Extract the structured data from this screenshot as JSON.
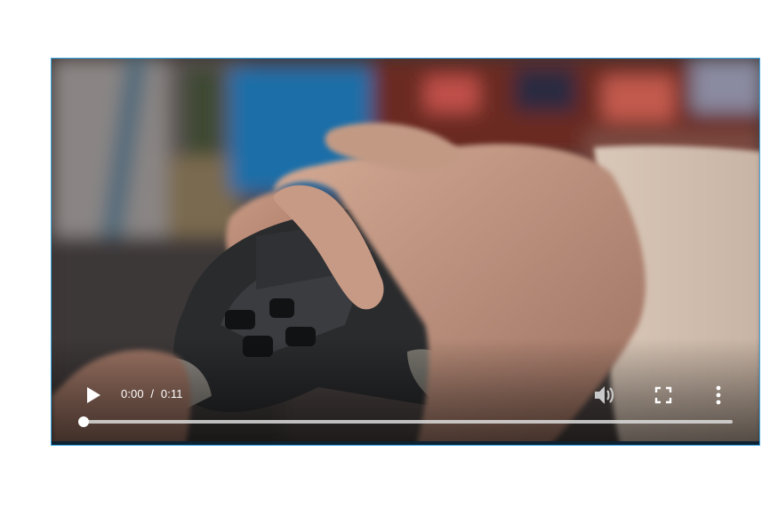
{
  "video": {
    "current_time": "0:00",
    "separator": "/",
    "duration": "0:11",
    "progress_fraction": 0.0,
    "muted": true
  },
  "icons": {
    "play": "play-icon",
    "volume": "volume-muted-icon",
    "fullscreen": "fullscreen-icon",
    "more": "more-vert-icon"
  },
  "colors": {
    "player_border": "#3aa7e6",
    "controls": "#ffffff"
  }
}
